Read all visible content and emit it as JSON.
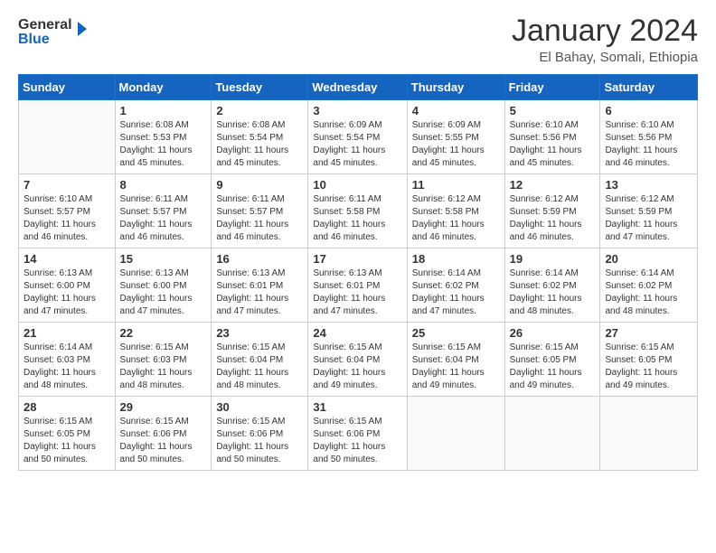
{
  "header": {
    "logo_general": "General",
    "logo_blue": "Blue",
    "month_title": "January 2024",
    "location": "El Bahay, Somali, Ethiopia"
  },
  "weekdays": [
    "Sunday",
    "Monday",
    "Tuesday",
    "Wednesday",
    "Thursday",
    "Friday",
    "Saturday"
  ],
  "weeks": [
    [
      {
        "day": "",
        "info": ""
      },
      {
        "day": "1",
        "info": "Sunrise: 6:08 AM\nSunset: 5:53 PM\nDaylight: 11 hours\nand 45 minutes."
      },
      {
        "day": "2",
        "info": "Sunrise: 6:08 AM\nSunset: 5:54 PM\nDaylight: 11 hours\nand 45 minutes."
      },
      {
        "day": "3",
        "info": "Sunrise: 6:09 AM\nSunset: 5:54 PM\nDaylight: 11 hours\nand 45 minutes."
      },
      {
        "day": "4",
        "info": "Sunrise: 6:09 AM\nSunset: 5:55 PM\nDaylight: 11 hours\nand 45 minutes."
      },
      {
        "day": "5",
        "info": "Sunrise: 6:10 AM\nSunset: 5:56 PM\nDaylight: 11 hours\nand 45 minutes."
      },
      {
        "day": "6",
        "info": "Sunrise: 6:10 AM\nSunset: 5:56 PM\nDaylight: 11 hours\nand 46 minutes."
      }
    ],
    [
      {
        "day": "7",
        "info": "Sunrise: 6:10 AM\nSunset: 5:57 PM\nDaylight: 11 hours\nand 46 minutes."
      },
      {
        "day": "8",
        "info": "Sunrise: 6:11 AM\nSunset: 5:57 PM\nDaylight: 11 hours\nand 46 minutes."
      },
      {
        "day": "9",
        "info": "Sunrise: 6:11 AM\nSunset: 5:57 PM\nDaylight: 11 hours\nand 46 minutes."
      },
      {
        "day": "10",
        "info": "Sunrise: 6:11 AM\nSunset: 5:58 PM\nDaylight: 11 hours\nand 46 minutes."
      },
      {
        "day": "11",
        "info": "Sunrise: 6:12 AM\nSunset: 5:58 PM\nDaylight: 11 hours\nand 46 minutes."
      },
      {
        "day": "12",
        "info": "Sunrise: 6:12 AM\nSunset: 5:59 PM\nDaylight: 11 hours\nand 46 minutes."
      },
      {
        "day": "13",
        "info": "Sunrise: 6:12 AM\nSunset: 5:59 PM\nDaylight: 11 hours\nand 47 minutes."
      }
    ],
    [
      {
        "day": "14",
        "info": "Sunrise: 6:13 AM\nSunset: 6:00 PM\nDaylight: 11 hours\nand 47 minutes."
      },
      {
        "day": "15",
        "info": "Sunrise: 6:13 AM\nSunset: 6:00 PM\nDaylight: 11 hours\nand 47 minutes."
      },
      {
        "day": "16",
        "info": "Sunrise: 6:13 AM\nSunset: 6:01 PM\nDaylight: 11 hours\nand 47 minutes."
      },
      {
        "day": "17",
        "info": "Sunrise: 6:13 AM\nSunset: 6:01 PM\nDaylight: 11 hours\nand 47 minutes."
      },
      {
        "day": "18",
        "info": "Sunrise: 6:14 AM\nSunset: 6:02 PM\nDaylight: 11 hours\nand 47 minutes."
      },
      {
        "day": "19",
        "info": "Sunrise: 6:14 AM\nSunset: 6:02 PM\nDaylight: 11 hours\nand 48 minutes."
      },
      {
        "day": "20",
        "info": "Sunrise: 6:14 AM\nSunset: 6:02 PM\nDaylight: 11 hours\nand 48 minutes."
      }
    ],
    [
      {
        "day": "21",
        "info": "Sunrise: 6:14 AM\nSunset: 6:03 PM\nDaylight: 11 hours\nand 48 minutes."
      },
      {
        "day": "22",
        "info": "Sunrise: 6:15 AM\nSunset: 6:03 PM\nDaylight: 11 hours\nand 48 minutes."
      },
      {
        "day": "23",
        "info": "Sunrise: 6:15 AM\nSunset: 6:04 PM\nDaylight: 11 hours\nand 48 minutes."
      },
      {
        "day": "24",
        "info": "Sunrise: 6:15 AM\nSunset: 6:04 PM\nDaylight: 11 hours\nand 49 minutes."
      },
      {
        "day": "25",
        "info": "Sunrise: 6:15 AM\nSunset: 6:04 PM\nDaylight: 11 hours\nand 49 minutes."
      },
      {
        "day": "26",
        "info": "Sunrise: 6:15 AM\nSunset: 6:05 PM\nDaylight: 11 hours\nand 49 minutes."
      },
      {
        "day": "27",
        "info": "Sunrise: 6:15 AM\nSunset: 6:05 PM\nDaylight: 11 hours\nand 49 minutes."
      }
    ],
    [
      {
        "day": "28",
        "info": "Sunrise: 6:15 AM\nSunset: 6:05 PM\nDaylight: 11 hours\nand 50 minutes."
      },
      {
        "day": "29",
        "info": "Sunrise: 6:15 AM\nSunset: 6:06 PM\nDaylight: 11 hours\nand 50 minutes."
      },
      {
        "day": "30",
        "info": "Sunrise: 6:15 AM\nSunset: 6:06 PM\nDaylight: 11 hours\nand 50 minutes."
      },
      {
        "day": "31",
        "info": "Sunrise: 6:15 AM\nSunset: 6:06 PM\nDaylight: 11 hours\nand 50 minutes."
      },
      {
        "day": "",
        "info": ""
      },
      {
        "day": "",
        "info": ""
      },
      {
        "day": "",
        "info": ""
      }
    ]
  ]
}
